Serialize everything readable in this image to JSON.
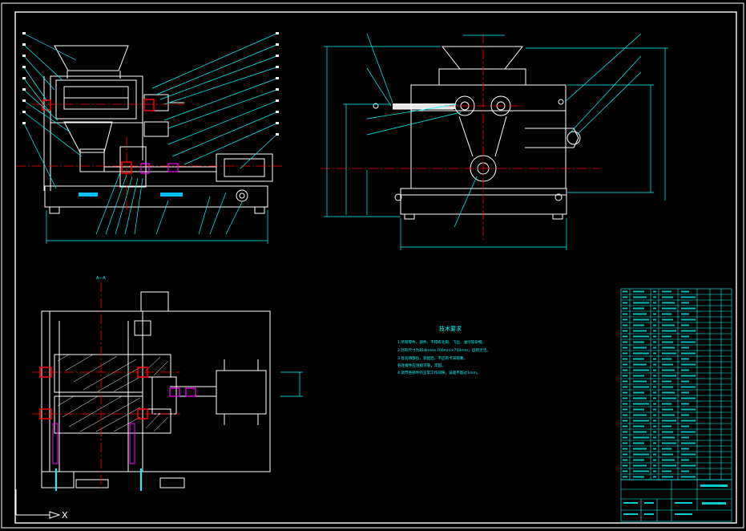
{
  "view_labels": {
    "front_view": "",
    "side_view_title": "",
    "side_view_subtitle": "",
    "section_title": "",
    "section_sub": "A—A"
  },
  "technical_requirements": {
    "title": "技术要求",
    "lines": [
      "1.所有零件、部件、不得有毛刺、飞边、油污等杂物。",
      "2.外形尺寸为818mm×700mm×750mm，运转灵活。",
      "3.各润滑部位，装配后，不应有卡滞现象。",
      "  各连接件应连接可靠，牢固。",
      "4.调节各部件的正常工作间隙，误差不超过1mm。"
    ]
  },
  "title_block": {
    "drawing_name": "",
    "scale_label": "",
    "sheet_label": ""
  },
  "ucs": {
    "axis_x": "X"
  },
  "colors": {
    "background": "#000000",
    "outline": "#ffffff",
    "dimension": "#00ffff",
    "centerline": "#ff0000",
    "hidden_feature": "#ff00ff",
    "highlight": "#00bfff"
  }
}
